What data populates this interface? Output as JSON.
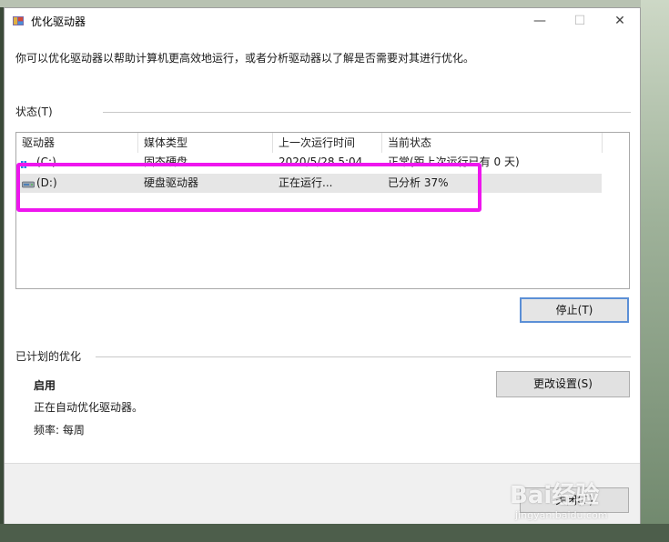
{
  "window": {
    "title": "优化驱动器",
    "controls": {
      "minimize": "—",
      "maximize": "☐",
      "close": "✕"
    }
  },
  "intro_text": "你可以优化驱动器以帮助计算机更高效地运行，或者分析驱动器以了解是否需要对其进行优化。",
  "status_section": {
    "label": "状态(T)",
    "columns": [
      "驱动器",
      "媒体类型",
      "上一次运行时间",
      "当前状态"
    ],
    "rows": [
      {
        "drive": "(C:)",
        "media": "固态硬盘",
        "last_run": "2020/5/28 5:04",
        "state": "正常(距上次运行已有 0 天)"
      },
      {
        "drive": "(D:)",
        "media": "硬盘驱动器",
        "last_run": "正在运行...",
        "state": "已分析 37%"
      }
    ],
    "stop_button": "停止(T)"
  },
  "scheduled_section": {
    "label": "已计划的优化",
    "status": "启用",
    "description": "正在自动优化驱动器。",
    "frequency": "频率: 每周",
    "change_settings_button": "更改设置(S)"
  },
  "footer": {
    "close_button": "关闭(C)"
  },
  "watermark": {
    "brand": "Bai经验",
    "site": "jingyan.baidu.com"
  },
  "colors": {
    "highlight": "#ee16ee",
    "default_button_border": "#5b8fd6",
    "selected_row": "#e6e6e6"
  }
}
